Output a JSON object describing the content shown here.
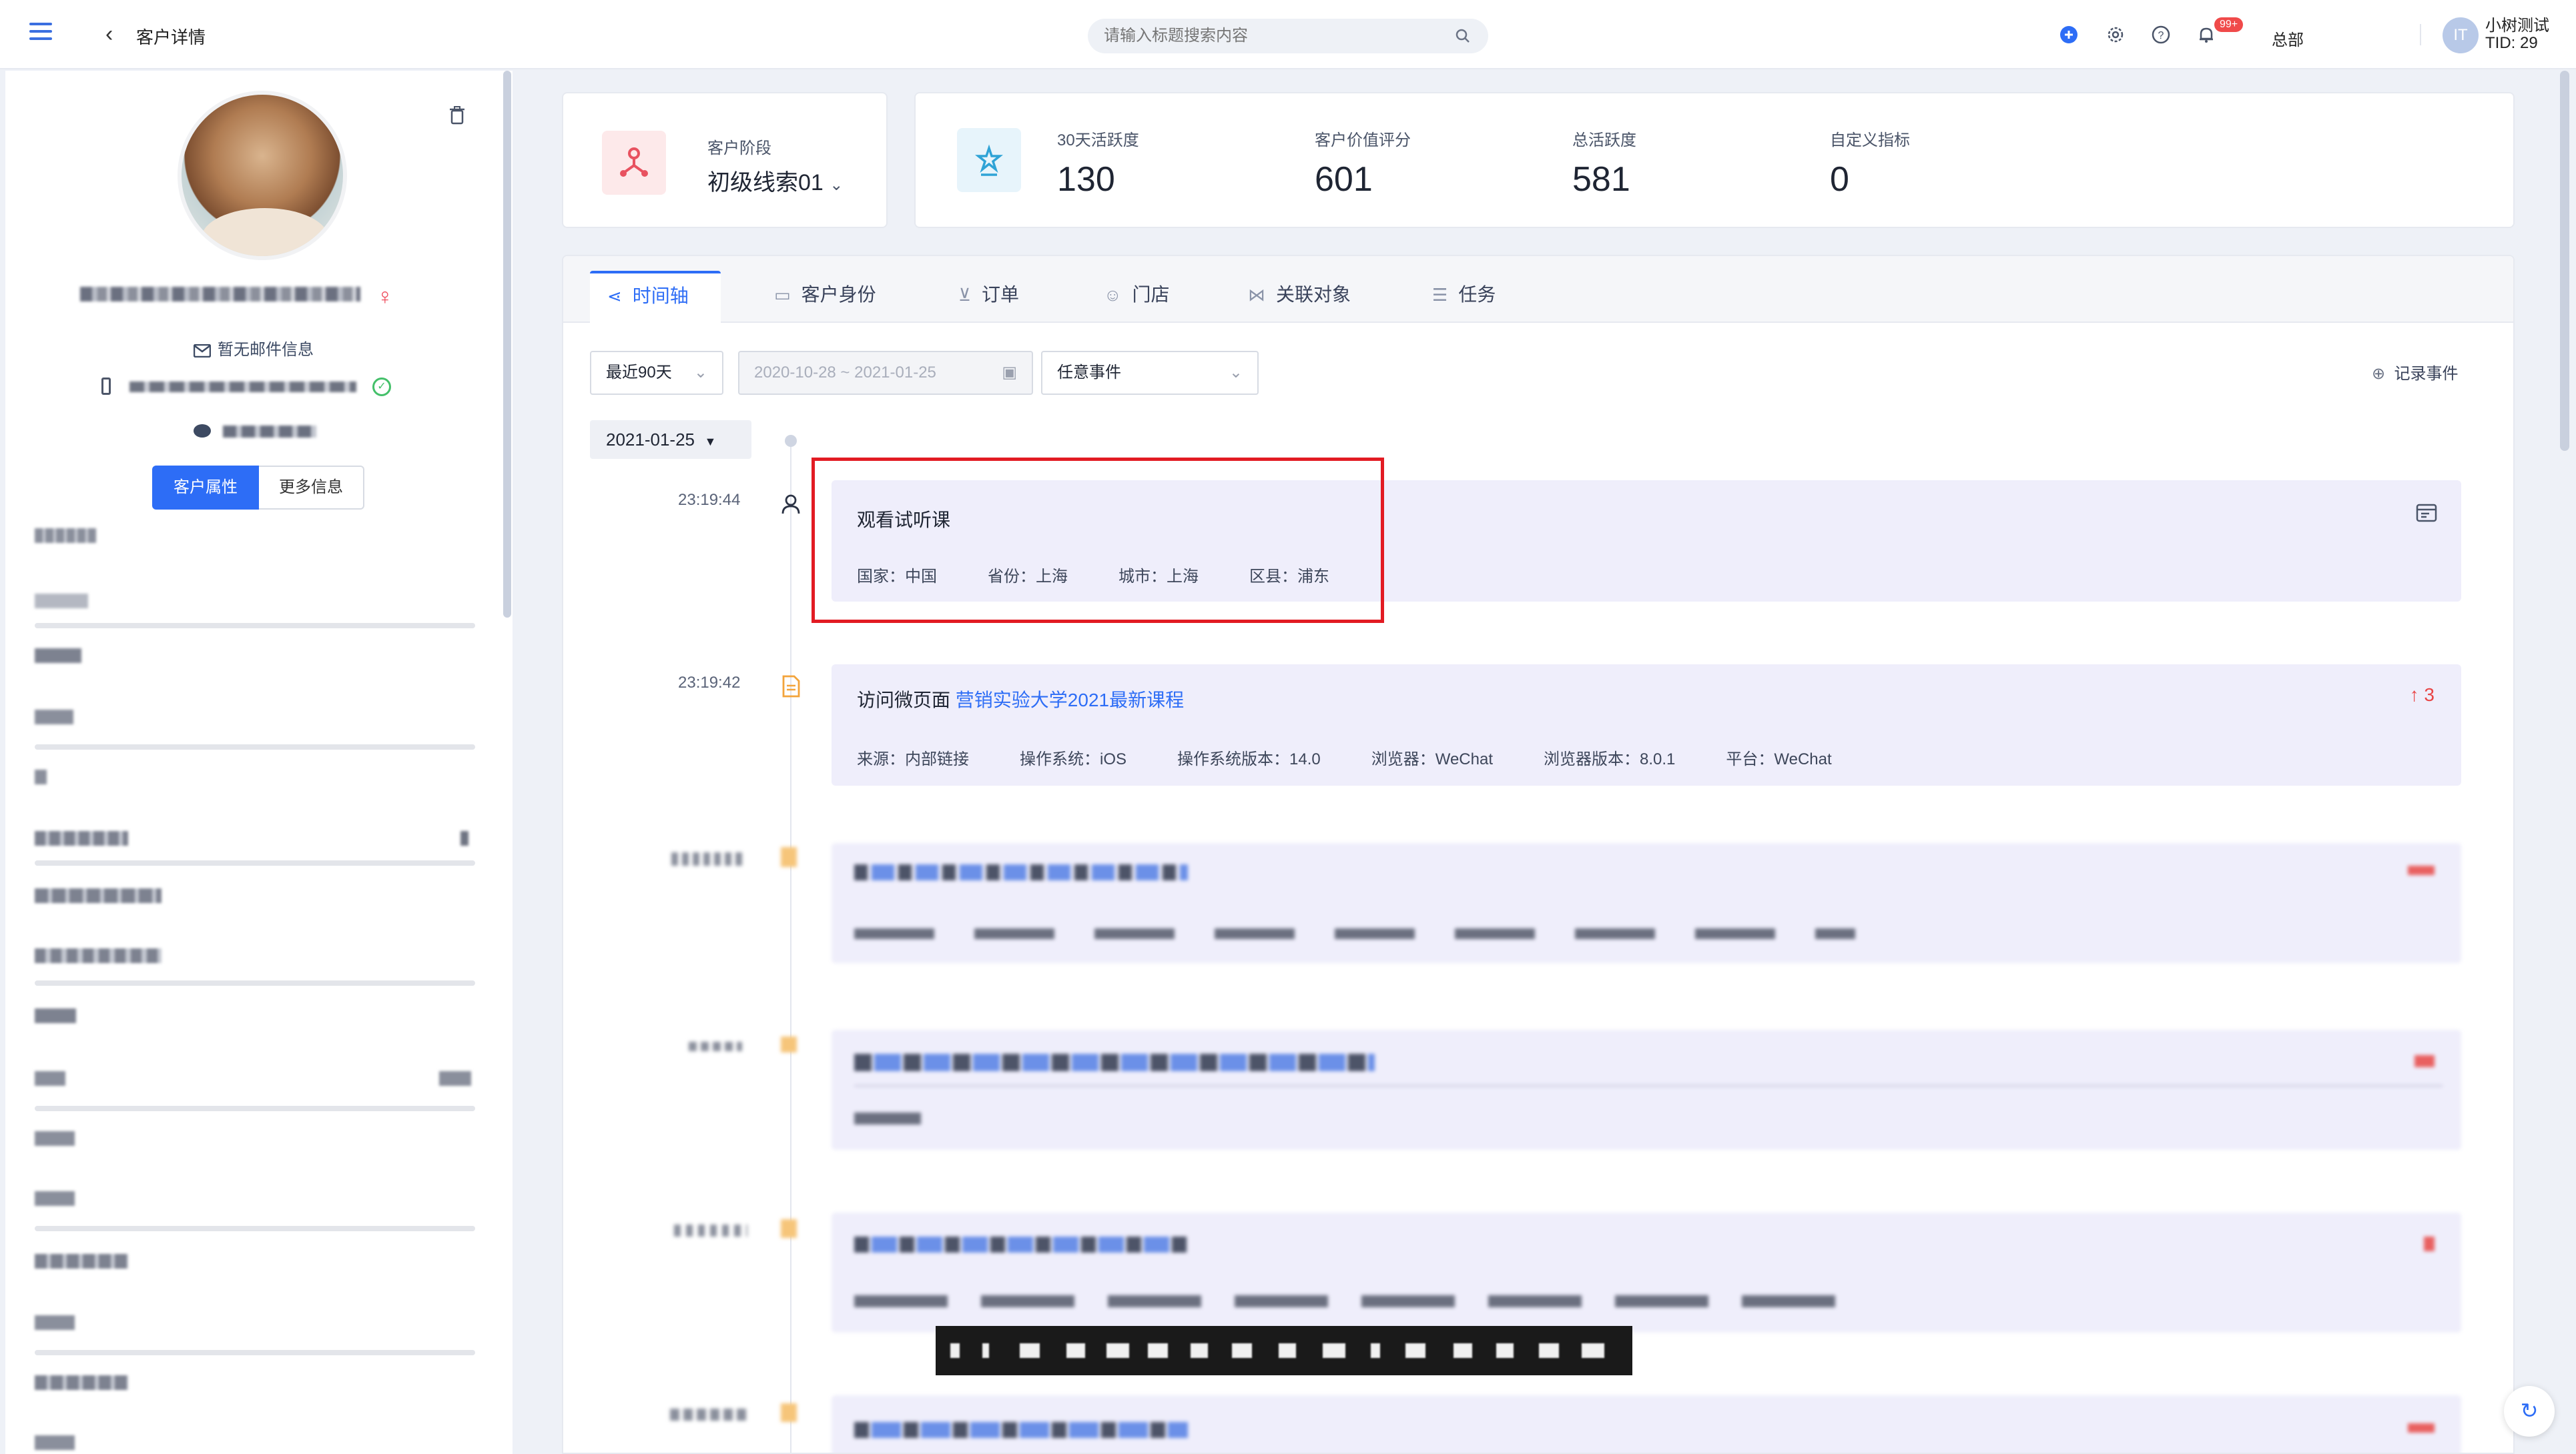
{
  "topbar": {
    "page_title": "客户详情",
    "search_placeholder": "请输入标题搜索内容",
    "notification_badge": "99+",
    "org": "总部",
    "user_name": "小树测试",
    "user_tid": "TID: 29",
    "avatar_text": "IT"
  },
  "profile": {
    "email": "暂无邮件信息",
    "buttons": {
      "attributes": "客户属性",
      "more": "更多信息"
    }
  },
  "stage": {
    "label": "客户阶段",
    "value": "初级线索01"
  },
  "metrics": [
    {
      "label": "30天活跃度",
      "value": "130"
    },
    {
      "label": "客户价值评分",
      "value": "601"
    },
    {
      "label": "总活跃度",
      "value": "581"
    },
    {
      "label": "自定义指标",
      "value": "0"
    }
  ],
  "tabs": [
    {
      "label": "时间轴",
      "icon": "share-icon"
    },
    {
      "label": "客户身份",
      "icon": "id-card-icon"
    },
    {
      "label": "订单",
      "icon": "cart-icon"
    },
    {
      "label": "门店",
      "icon": "store-icon"
    },
    {
      "label": "关联对象",
      "icon": "link-icon"
    },
    {
      "label": "任务",
      "icon": "list-icon"
    }
  ],
  "filters": {
    "period": "最近90天",
    "date_range": "2020-10-28  ~  2021-01-25",
    "event_type": "任意事件",
    "record": "记录事件"
  },
  "timeline": {
    "date": "2021-01-25",
    "events": [
      {
        "time": "23:19:44",
        "title": "观看试听课",
        "meta": [
          "国家：中国",
          "省份：上海",
          "城市：上海",
          "区县：浦东"
        ]
      },
      {
        "time": "23:19:42",
        "title_prefix": "访问微页面",
        "title_link": "营销实验大学2021最新课程",
        "count": "3",
        "meta": [
          "来源：内部链接",
          "操作系统：iOS",
          "操作系统版本：14.0",
          "浏览器：WeChat",
          "浏览器版本：8.0.1",
          "平台：WeChat"
        ]
      }
    ]
  },
  "colors": {
    "accent": "#2d6df6",
    "highlight": "#e21b23",
    "event_bg": "#efeefb"
  }
}
